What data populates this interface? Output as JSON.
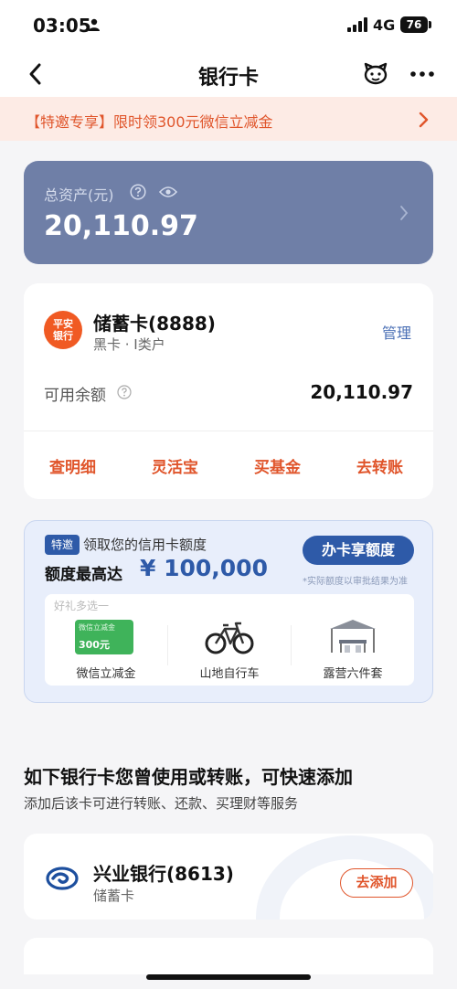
{
  "status_bar": {
    "time": "03:05",
    "network": "4G",
    "battery": "76"
  },
  "nav": {
    "title": "银行卡"
  },
  "promo": {
    "text": "【特邀专享】限时领300元微信立减金"
  },
  "assets": {
    "label": "总资产(元)",
    "amount": "20,110.97"
  },
  "debit_card": {
    "logo_text": [
      "平安",
      "银行"
    ],
    "name": "储蓄卡(8888)",
    "subtitle": "黑卡 · I类户",
    "manage_label": "管理",
    "balance_label": "可用余额",
    "balance_value": "20,110.97",
    "actions": [
      {
        "label": "查明细"
      },
      {
        "label": "灵活宝"
      },
      {
        "label": "买基金"
      },
      {
        "label": "去转账"
      }
    ]
  },
  "credit_offer": {
    "badge": "特邀",
    "title": "领取您的信用卡额度",
    "limit_label": "额度最高达",
    "limit_amount": "¥ 100,000",
    "apply_label": "办卡享额度",
    "disclaimer": "*实际额度以审批结果为准",
    "gift_header": "好礼多选一",
    "coupon_small": "微信立减金",
    "coupon_value": "300元",
    "gifts": [
      {
        "label": "微信立减金"
      },
      {
        "label": "山地自行车"
      },
      {
        "label": "露营六件套"
      }
    ]
  },
  "quick_add": {
    "title": "如下银行卡您曾使用或转账，可快速添加",
    "subtitle": "添加后该卡可进行转账、还款、买理财等服务",
    "banks": [
      {
        "name": "兴业银行(8613)",
        "type": "储蓄卡",
        "add_label": "去添加"
      }
    ]
  },
  "colors": {
    "accent": "#e0552b",
    "asset_card": "#6f7fa7",
    "credit_blue": "#2e5aa8",
    "link_blue": "#4a6fb5"
  }
}
